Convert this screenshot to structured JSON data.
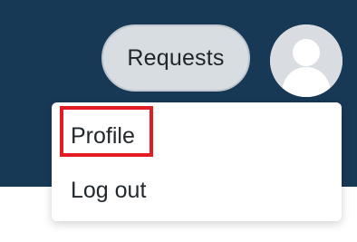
{
  "header": {
    "requests_button_label": "Requests"
  },
  "user_menu": {
    "items": [
      {
        "label": "Profile",
        "highlighted": true
      },
      {
        "label": "Log out",
        "highlighted": false
      }
    ]
  },
  "icons": {
    "avatar": "default-user-avatar-icon"
  },
  "colors": {
    "header_background": "#173956",
    "button_background": "#d8dde2",
    "menu_background": "#ffffff",
    "highlight_border": "#e31b23"
  }
}
